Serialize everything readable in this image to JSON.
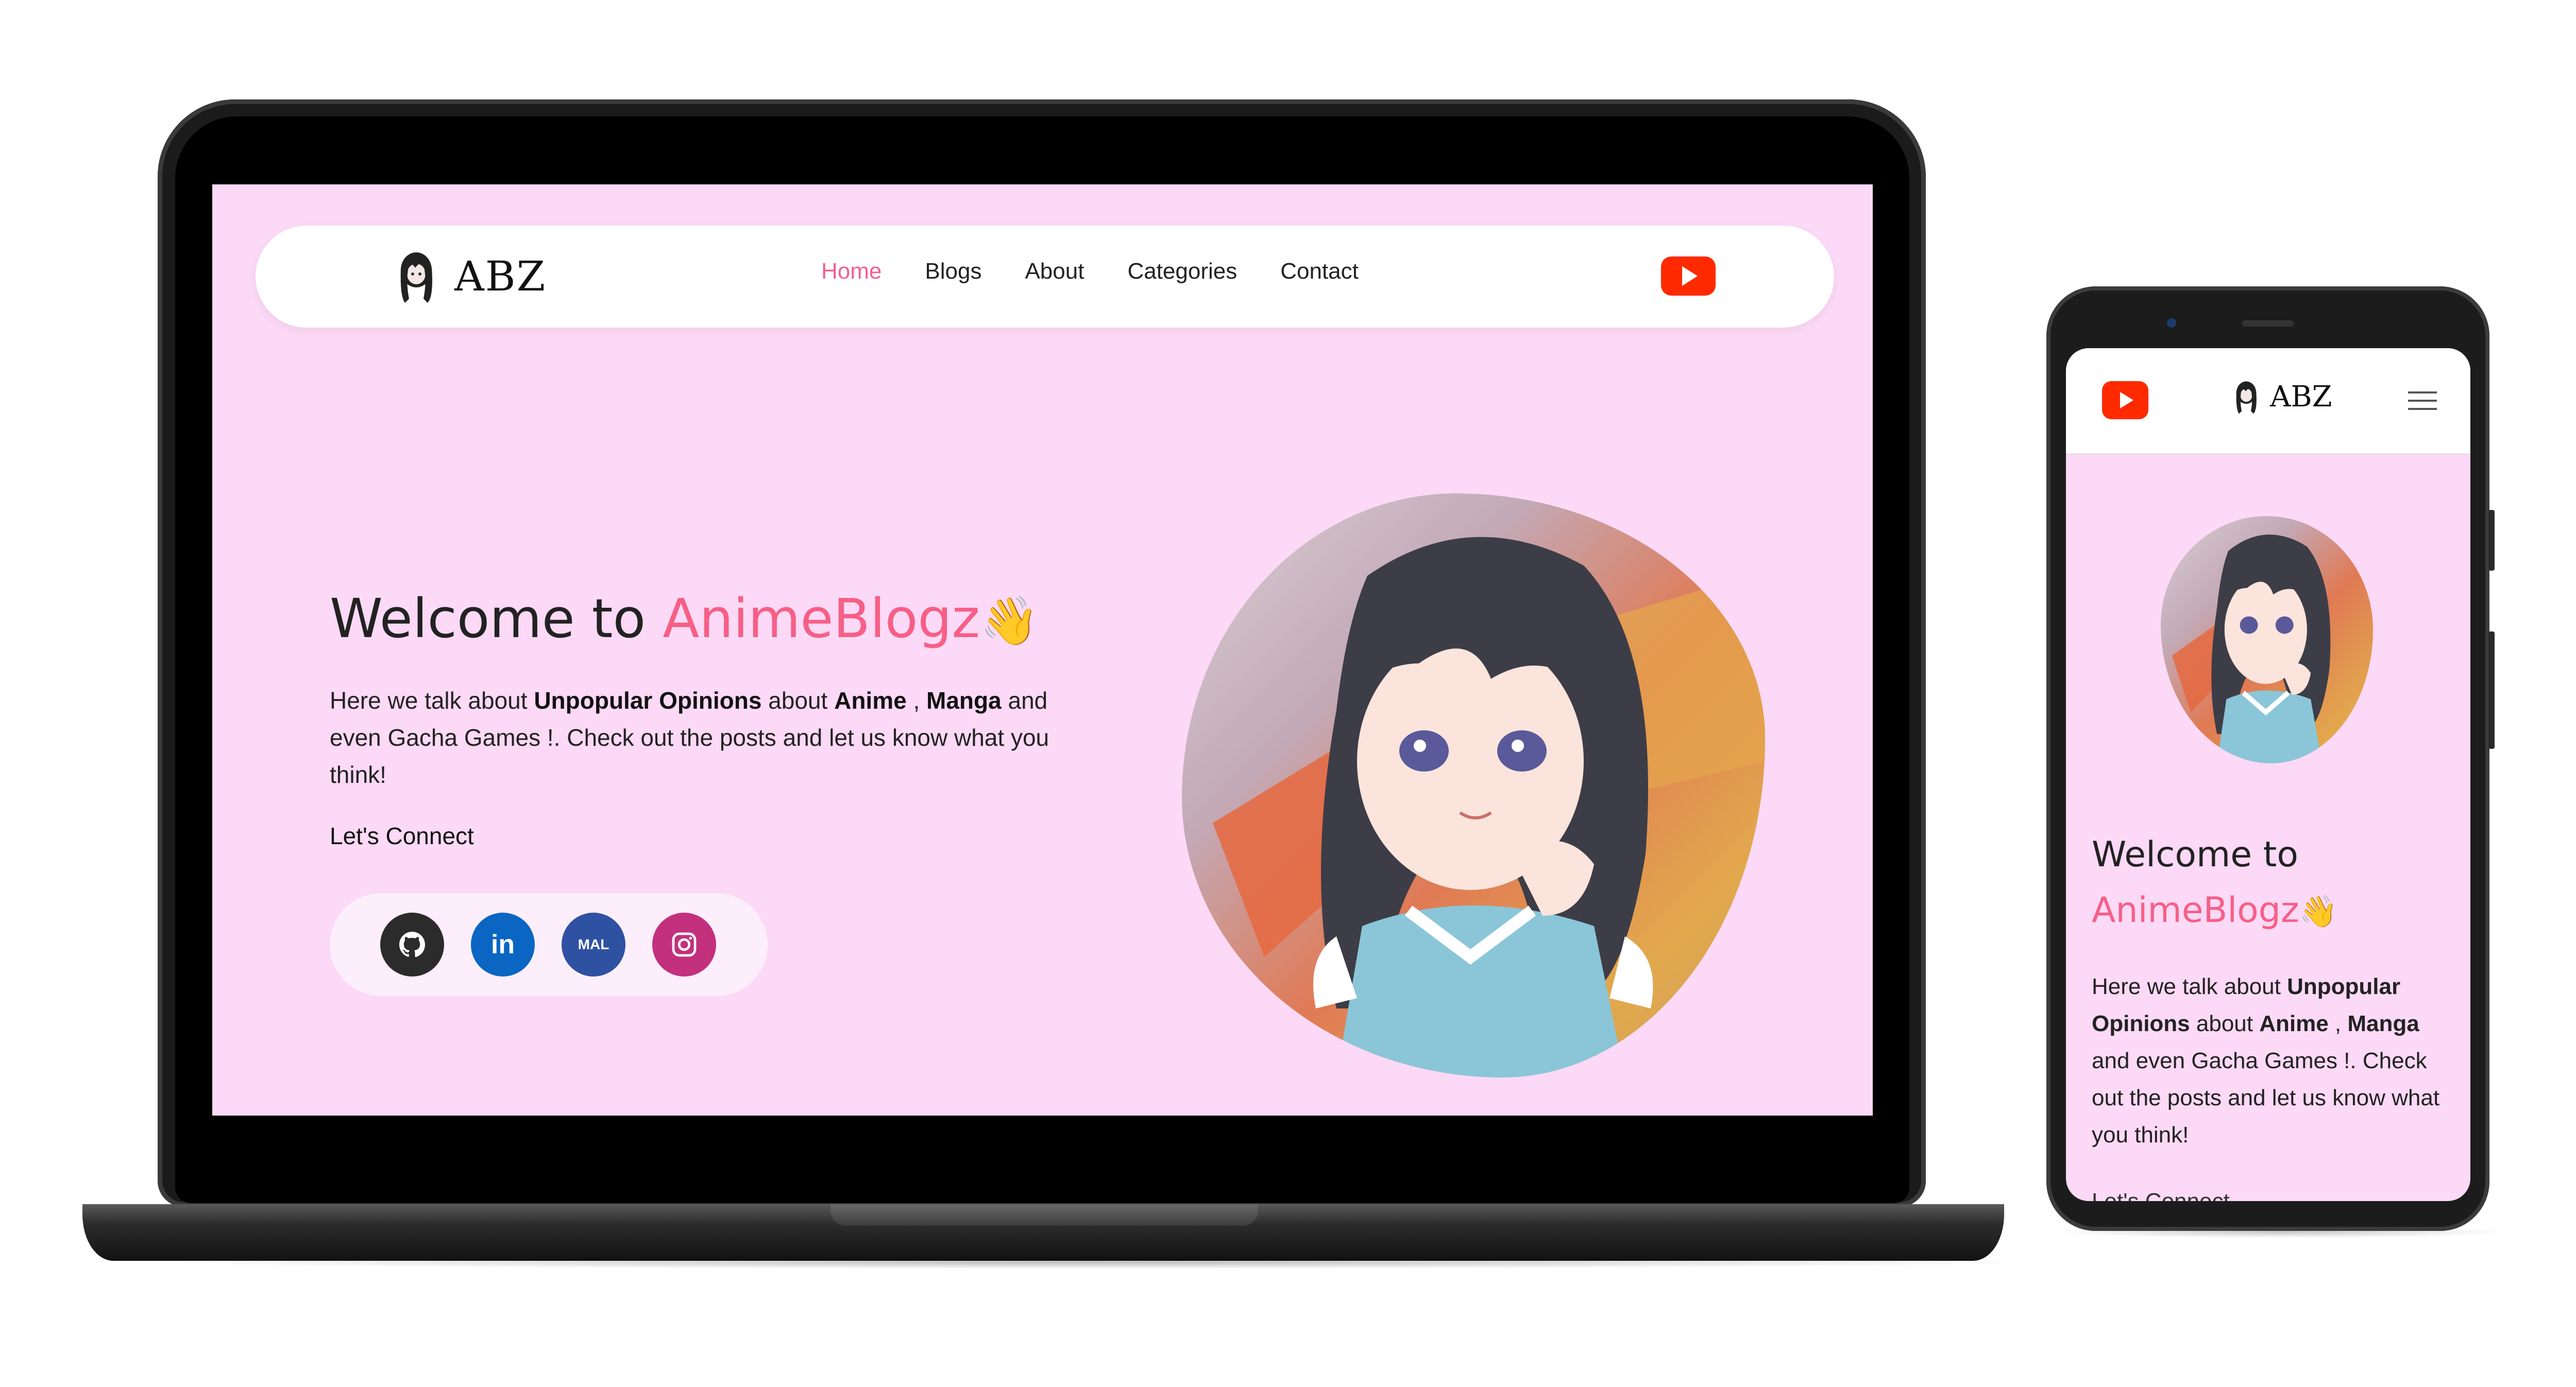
{
  "brand": {
    "logo_text": "ABZ"
  },
  "nav": {
    "items": [
      "Home",
      "Blogs",
      "About",
      "Categories",
      "Contact"
    ],
    "active": "Home"
  },
  "hero": {
    "title_prefix": "Welcome to ",
    "title_accent": "AnimeBlogz",
    "wave_emoji": "👋",
    "desc_1": "Here we talk about ",
    "desc_bold_1": "Unpopular Opinions",
    "desc_2": " about ",
    "desc_bold_2": "Anime",
    "desc_3": " , ",
    "desc_bold_3": "Manga",
    "desc_4": " and even Gacha Games !. Check out the posts and let us know what you think!",
    "connect_label": "Let's Connect"
  },
  "social": [
    {
      "name": "github",
      "label": "",
      "color": "#2b2b2b"
    },
    {
      "name": "linkedin",
      "label": "in",
      "color": "#0a66c2"
    },
    {
      "name": "myanimelist",
      "label": "MAL",
      "color": "#2e51a2"
    },
    {
      "name": "instagram",
      "label": "",
      "color": "#c2307e"
    }
  ],
  "colors": {
    "page_bg": "#fcd9f6",
    "accent": "#f65f86",
    "nav_active": "#f0608f",
    "youtube": "#ff2a00"
  },
  "mobile": {
    "title_line1": "Welcome to",
    "title_accent": "AnimeBlogz",
    "cut_text": "Let's Connect"
  }
}
